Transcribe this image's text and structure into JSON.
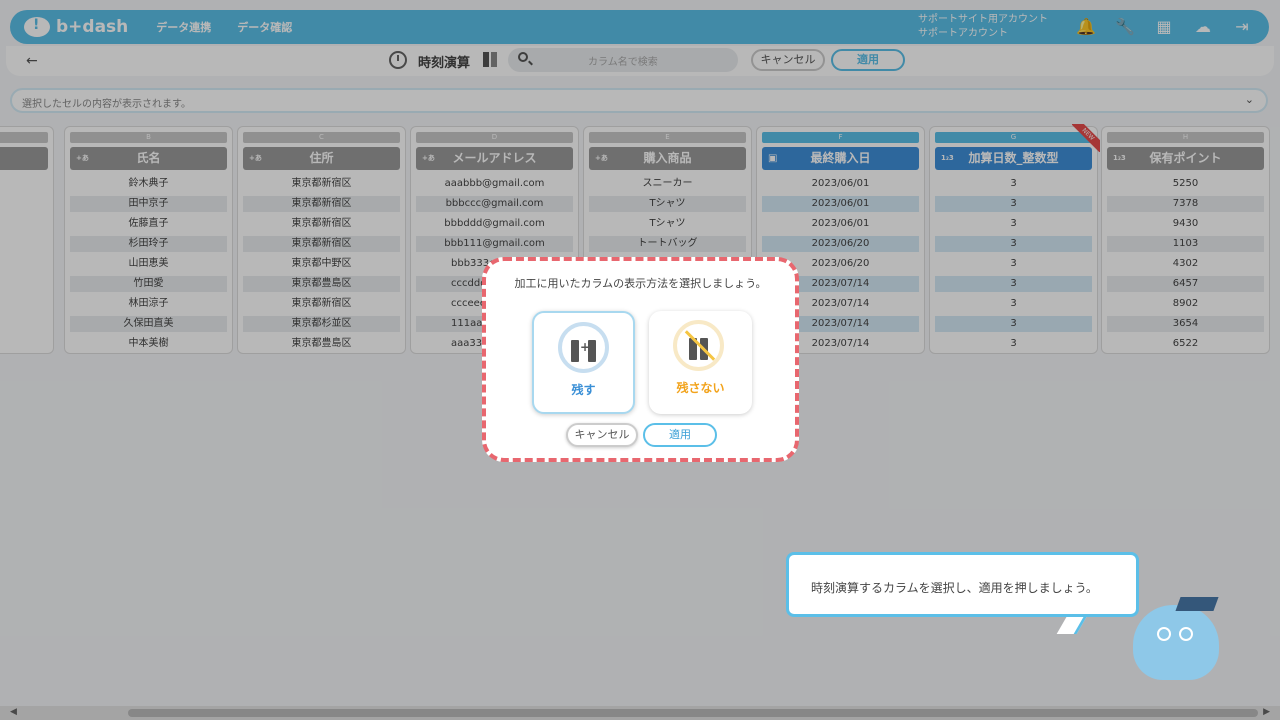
{
  "nav": {
    "logo": "b+dash",
    "links": [
      "データ連携",
      "データ確認"
    ],
    "account_line1": "サポートサイト用アカウント",
    "account_line2": "サポートアカウント",
    "icons": [
      "bell-icon",
      "wrench-icon",
      "apps-grid-icon",
      "chat-icon",
      "logout-icon"
    ]
  },
  "toolbar": {
    "back": "←",
    "title": "時刻演算",
    "search_placeholder": "カラム名で検索",
    "cancel": "キャンセル",
    "apply": "適用"
  },
  "cellbar": {
    "text": "選択したセルの内容が表示されます。",
    "chevron": "⌄"
  },
  "columns": [
    {
      "letter": "B",
      "type": "+あ",
      "header": "氏名",
      "cells": [
        "鈴木典子",
        "田中京子",
        "佐藤直子",
        "杉田玲子",
        "山田恵美",
        "竹田愛",
        "林田涼子",
        "久保田直美",
        "中本美樹"
      ]
    },
    {
      "letter": "C",
      "type": "+あ",
      "header": "住所",
      "cells": [
        "東京都新宿区",
        "東京都新宿区",
        "東京都新宿区",
        "東京都新宿区",
        "東京都中野区",
        "東京都豊島区",
        "東京都新宿区",
        "東京都杉並区",
        "東京都豊島区"
      ]
    },
    {
      "letter": "D",
      "type": "+あ",
      "header": "メールアドレス",
      "cells": [
        "aaabbb@gmail.com",
        "bbbccc@gmail.com",
        "bbbddd@gmail.com",
        "bbb111@gmail.com",
        "bbb333c",
        "cccddd",
        "ccceee",
        "111aa",
        "aaa333"
      ]
    },
    {
      "letter": "E",
      "type": "+あ",
      "header": "購入商品",
      "cells": [
        "スニーカー",
        "Tシャツ",
        "Tシャツ",
        "トートバッグ"
      ]
    },
    {
      "letter": "F",
      "type": "▣",
      "header": "最終購入日",
      "cells": [
        "2023/06/01",
        "2023/06/01",
        "2023/06/01",
        "2023/06/20",
        "2023/06/20",
        "2023/07/14",
        "2023/07/14",
        "2023/07/14",
        "2023/07/14"
      ]
    },
    {
      "letter": "G",
      "type": "1₂3",
      "header": "加算日数_整数型",
      "badge": "NEW",
      "cells": [
        "3",
        "3",
        "3",
        "3",
        "3",
        "3",
        "3",
        "3",
        "3"
      ]
    },
    {
      "letter": "H",
      "type": "1₂3",
      "header": "保有ポイント",
      "cells": [
        "5250",
        "7378",
        "9430",
        "1103",
        "4302",
        "6457",
        "8902",
        "3654",
        "6522"
      ]
    }
  ],
  "modal": {
    "title": "加工に用いたカラムの表示方法を選択しましょう。",
    "keep_label": "残す",
    "nokeep_label": "残さない",
    "plus": "+",
    "cancel": "キャンセル",
    "apply": "適用"
  },
  "tutorial": {
    "message": "時刻演算するカラムを選択し、適用を押しましょう。"
  },
  "colors": {
    "brand": "#5bbfe8",
    "selected_header": "#3f8fd8",
    "modal_border": "#e8676f",
    "keep": "#3a8fd6",
    "nokeep": "#f2a31c"
  }
}
